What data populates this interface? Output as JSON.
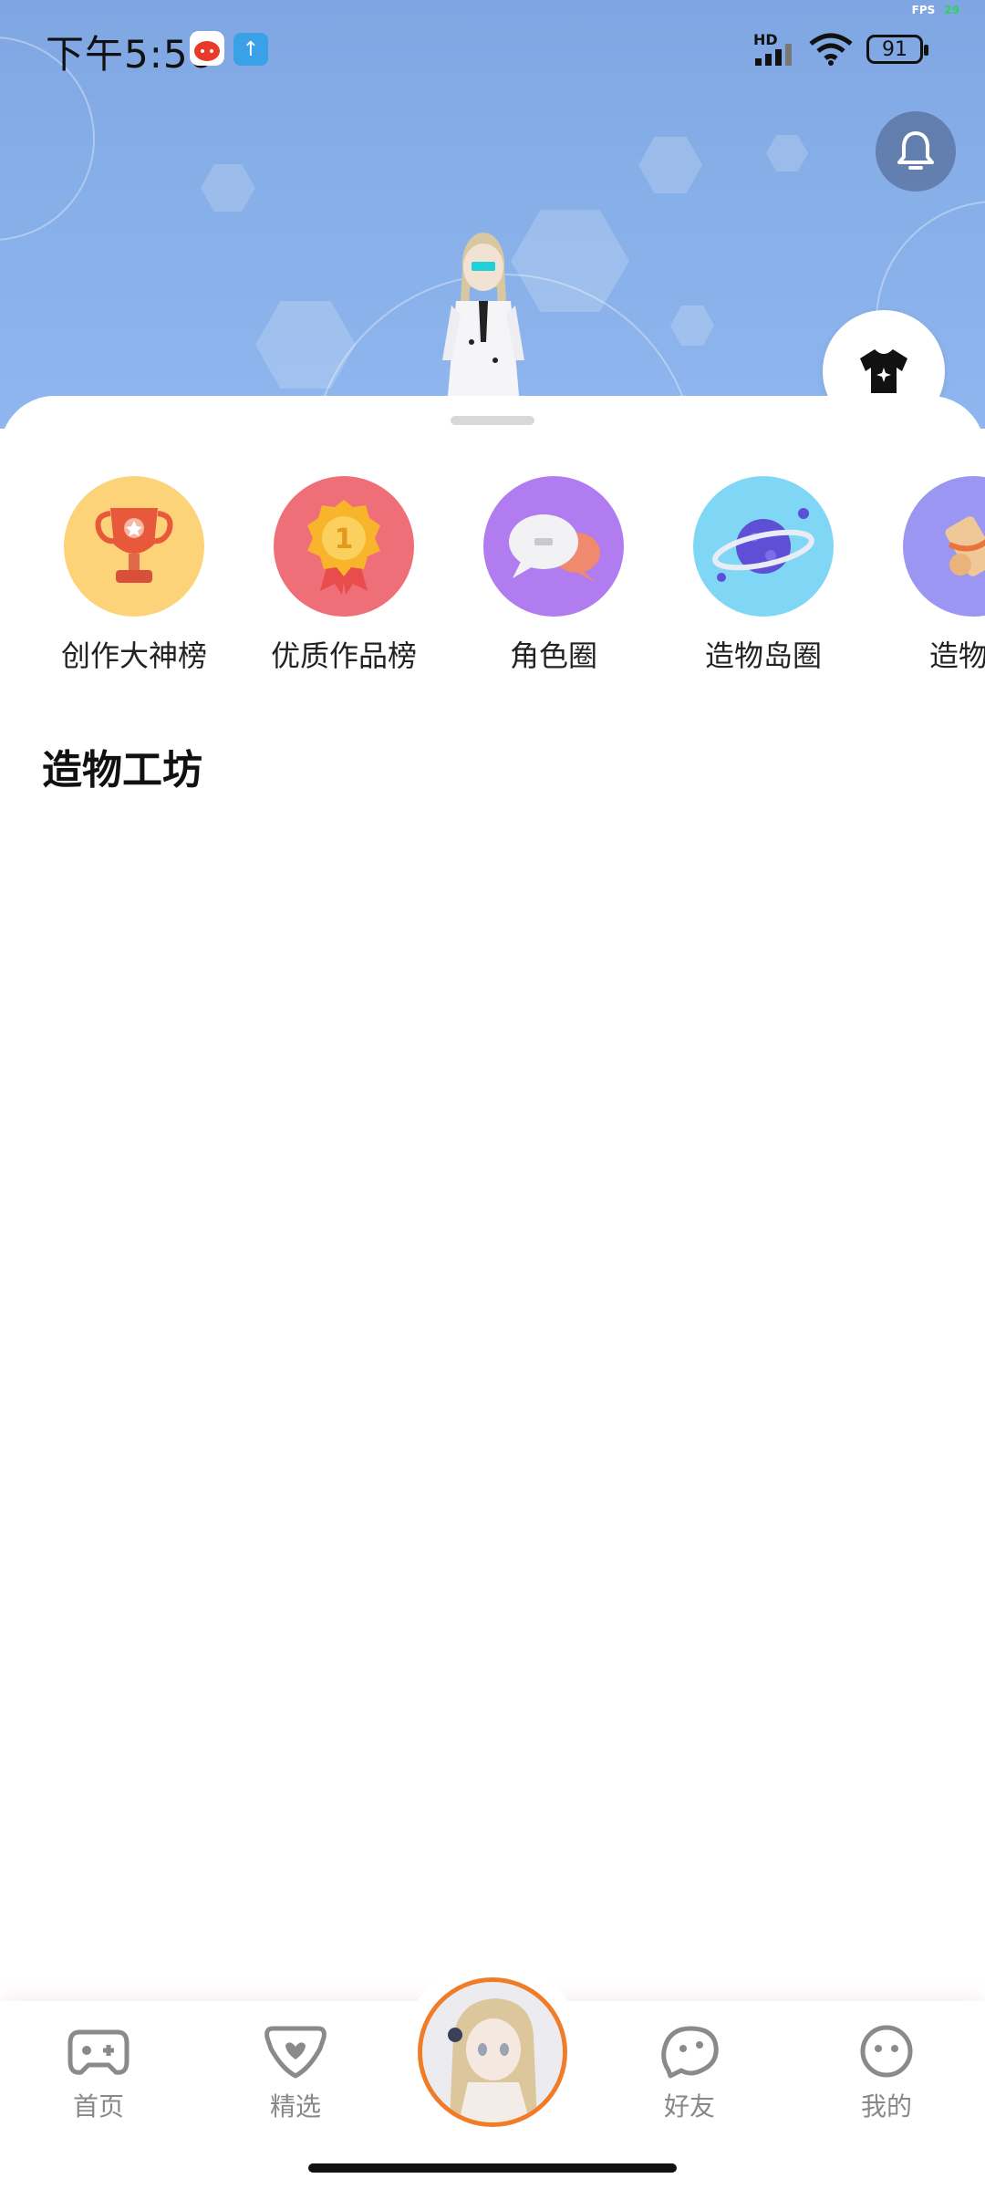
{
  "status_bar": {
    "time": "下午5:56",
    "network_badge": "HD",
    "battery": "91",
    "fps_label": "FPS",
    "fps_value": "29"
  },
  "header": {
    "notification_icon": "bell-icon",
    "outfit_icon": "tshirt-icon"
  },
  "quick_links": [
    {
      "label": "创作大神榜",
      "icon": "trophy-icon",
      "bg": "#fdd37a"
    },
    {
      "label": "优质作品榜",
      "icon": "medal-icon",
      "bg": "#ef6f78"
    },
    {
      "label": "角色圈",
      "icon": "chat-bubbles-icon",
      "bg": "#b07cf0"
    },
    {
      "label": "造物岛圈",
      "icon": "planet-icon",
      "bg": "#7fd7f5"
    },
    {
      "label": "造物教",
      "icon": "scroll-icon",
      "bg": "#9a96f2"
    }
  ],
  "section": {
    "title": "造物工坊"
  },
  "bottom_nav": {
    "items": [
      {
        "label": "首页",
        "icon": "gamepad-icon"
      },
      {
        "label": "精选",
        "icon": "heart-badge-icon"
      },
      {
        "label": "好友",
        "icon": "ghost-icon"
      },
      {
        "label": "我的",
        "icon": "face-icon"
      }
    ],
    "center": "avatar",
    "accent": "#f07c28"
  }
}
